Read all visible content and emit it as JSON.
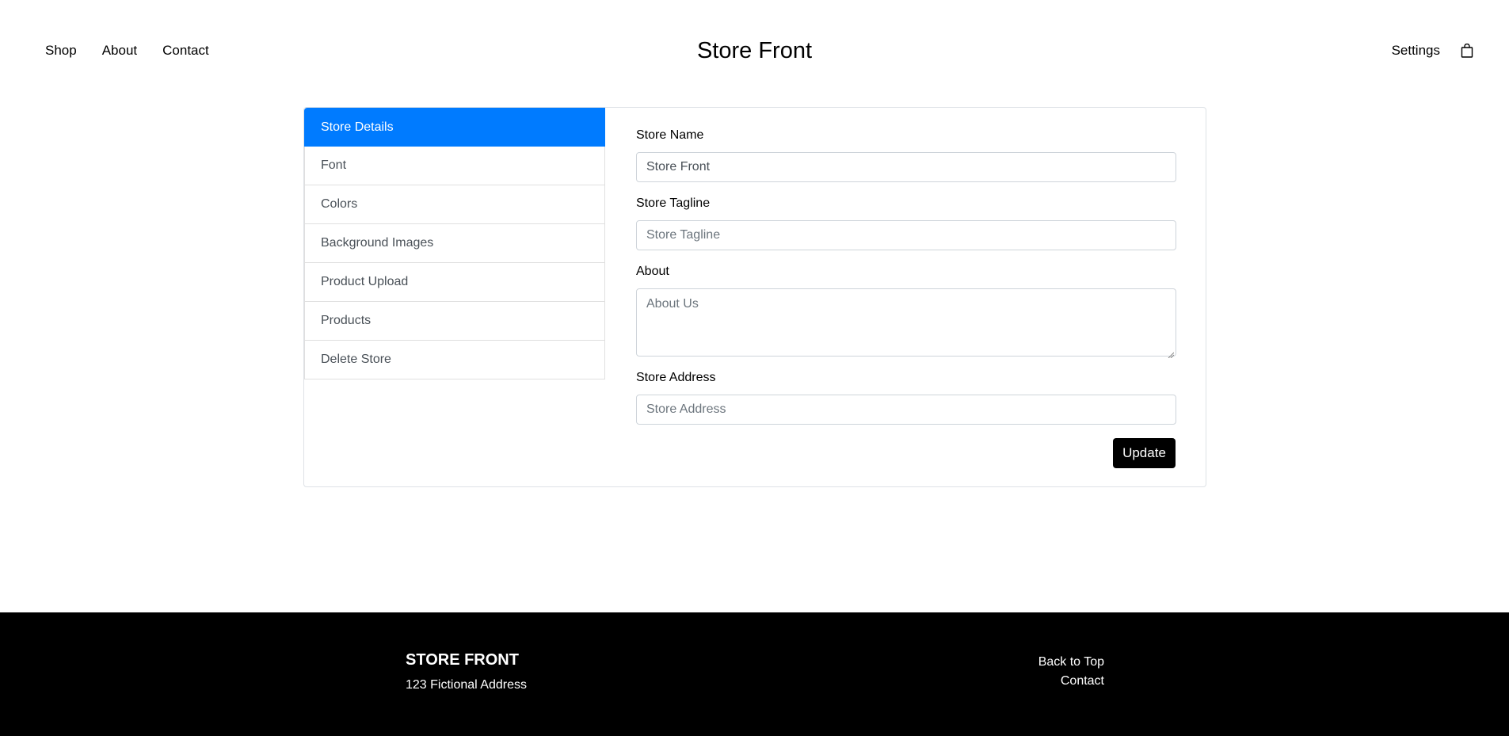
{
  "header": {
    "nav_left": [
      "Shop",
      "About",
      "Contact"
    ],
    "brand": "Store Front",
    "settings_label": "Settings",
    "cart_icon": "shopping-bag-icon"
  },
  "sidebar": {
    "items": [
      {
        "label": "Store Details",
        "active": true
      },
      {
        "label": "Font",
        "active": false
      },
      {
        "label": "Colors",
        "active": false
      },
      {
        "label": "Background Images",
        "active": false
      },
      {
        "label": "Product Upload",
        "active": false
      },
      {
        "label": "Products",
        "active": false
      },
      {
        "label": "Delete Store",
        "active": false
      }
    ]
  },
  "form": {
    "store_name": {
      "label": "Store Name",
      "value": "Store Front",
      "placeholder": ""
    },
    "store_tagline": {
      "label": "Store Tagline",
      "value": "",
      "placeholder": "Store Tagline"
    },
    "about": {
      "label": "About",
      "value": "",
      "placeholder": "About Us"
    },
    "store_address": {
      "label": "Store Address",
      "value": "",
      "placeholder": "Store Address"
    },
    "submit_label": "Update"
  },
  "footer": {
    "brand": "STORE FRONT",
    "address": "123 Fictional Address",
    "links": [
      "Back to Top",
      "Contact"
    ]
  },
  "colors": {
    "accent": "#007bff",
    "footer_bg": "#000000",
    "button_bg": "#000000"
  }
}
